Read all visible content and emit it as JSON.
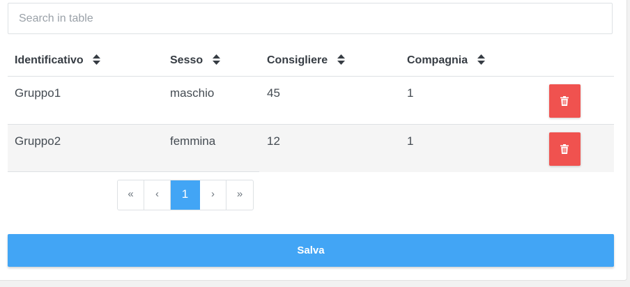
{
  "search": {
    "placeholder": "Search in table",
    "value": ""
  },
  "table": {
    "columns": [
      "Identificativo",
      "Sesso",
      "Consigliere",
      "Compagnia"
    ],
    "rows": [
      [
        "Gruppo1",
        "maschio",
        "45",
        "1"
      ],
      [
        "Gruppo2",
        "femmina",
        "12",
        "1"
      ]
    ],
    "icons": {
      "sort": "sort-icon",
      "delete": "trash-icon"
    }
  },
  "pagination": {
    "first": "«",
    "prev": "‹",
    "current": "1",
    "next": "›",
    "last": "»"
  },
  "actions": {
    "save_label": "Salva"
  },
  "colors": {
    "primary": "#42a5f5",
    "danger": "#f0524f"
  }
}
